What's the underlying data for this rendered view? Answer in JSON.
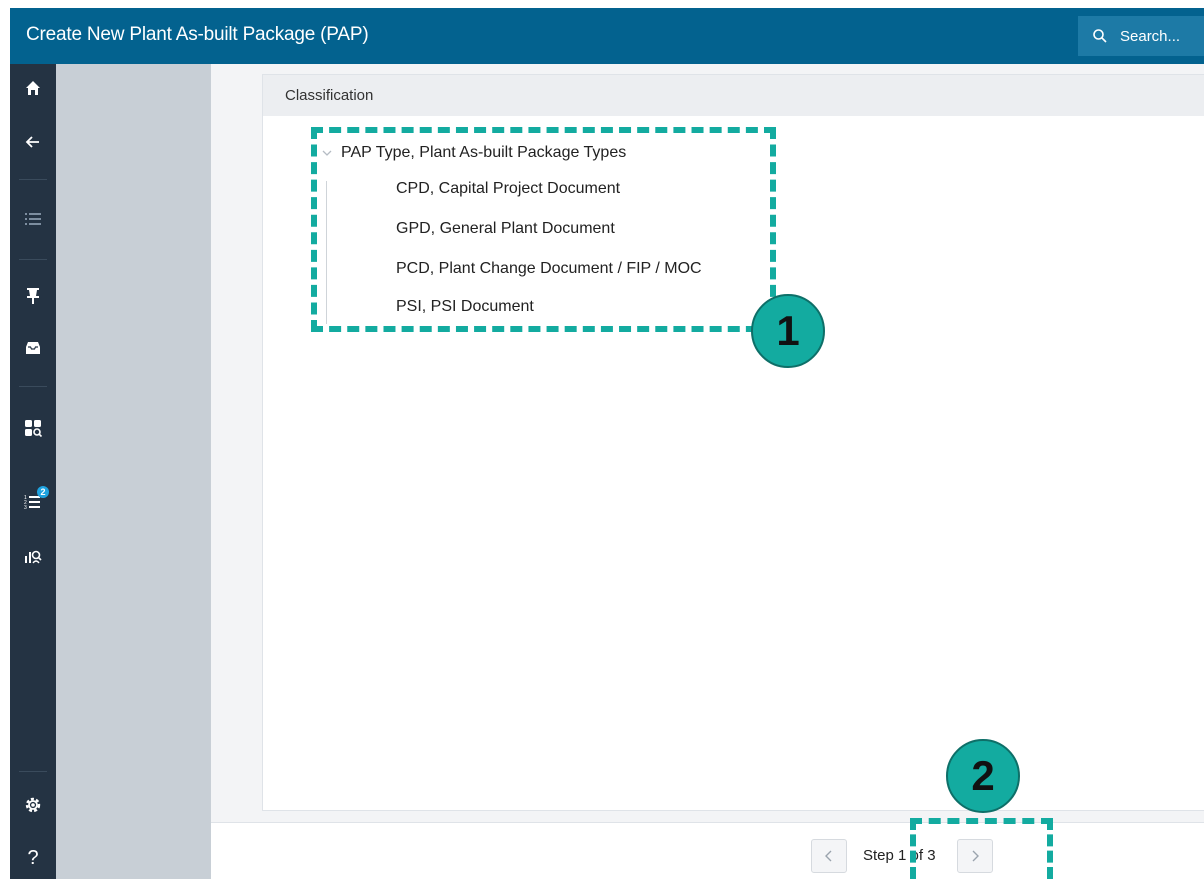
{
  "header": {
    "title": "Create New Plant As-built Package (PAP)",
    "search_placeholder": "Search..."
  },
  "rail": {
    "icons": [
      "home-icon",
      "back-arrow-icon",
      "list-icon",
      "pin-icon",
      "inbox-icon",
      "widget-search-icon",
      "ordered-list-icon",
      "chart-search-icon",
      "settings-icon",
      "help-icon"
    ],
    "badge_count": "2",
    "help_glyph": "?"
  },
  "classification": {
    "heading": "Classification",
    "root_label": "PAP Type, Plant As-built Package Types",
    "children": [
      "CPD, Capital Project Document",
      "GPD, General Plant Document",
      "PCD, Plant Change Document / FIP / MOC",
      "PSI, PSI Document"
    ]
  },
  "footer": {
    "step_text": "Step 1 of 3"
  },
  "annotations": {
    "marker_1": "1",
    "marker_2": "2"
  },
  "colors": {
    "header_bg": "#03628f",
    "rail_bg": "#243343",
    "annotation": "#13aba0"
  }
}
